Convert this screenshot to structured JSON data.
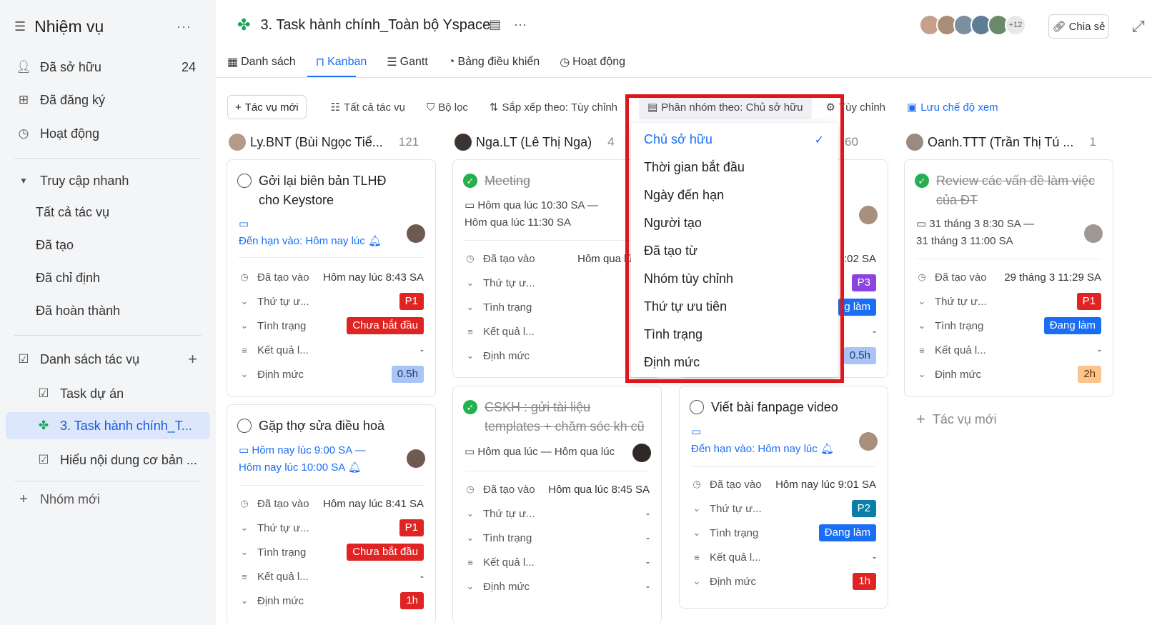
{
  "sidebar": {
    "title": "Nhiệm vụ",
    "more": "···",
    "items": [
      {
        "label": "Đã sở hữu",
        "count": "24"
      },
      {
        "label": "Đã đăng ký"
      },
      {
        "label": "Hoạt động"
      }
    ],
    "quick_access": {
      "label": "Truy cập nhanh",
      "items": [
        "Tất cả tác vụ",
        "Đã tạo",
        "Đã chỉ định",
        "Đã hoàn thành"
      ]
    },
    "task_lists": {
      "label": "Danh sách tác vụ",
      "items": [
        "Task dự án",
        "3. Task hành chính_T...",
        "Hiểu nội dung cơ bản ..."
      ]
    },
    "new_group": "Nhóm mới"
  },
  "header": {
    "title": "3. Task hành chính_Toàn bộ Yspace",
    "avatars_more": "+12",
    "share": "Chia sẻ"
  },
  "tabs": [
    "Danh sách",
    "Kanban",
    "Gantt",
    "Bảng điều khiển",
    "Hoạt động"
  ],
  "toolbar": {
    "new_task": "Tác vụ mới",
    "all_tasks": "Tất cả tác vụ",
    "filter": "Bộ lọc",
    "sort": "Sắp xếp theo: Tùy chỉnh",
    "group": "Phân nhóm theo: Chủ sở hữu",
    "customize": "Tùy chỉnh",
    "save_view": "Lưu chế độ xem"
  },
  "columns": [
    {
      "name": "Ly.BNT (Bùi Ngọc Tiể...",
      "count": "121"
    },
    {
      "name": "Nga.LT (Lê Thị Nga)",
      "count": "4"
    },
    {
      "name": "",
      "count": "60"
    },
    {
      "name": "Oanh.TTT (Trần Thị Tú ...",
      "count": "1"
    }
  ],
  "fields": {
    "created": "Đã tạo vào",
    "priority": "Thứ tự ư...",
    "status": "Tình trạng",
    "result": "Kết quả l...",
    "estimate": "Định mức"
  },
  "cards": {
    "c1": {
      "title": "Gởi lại biên bản TLHĐ cho Keystore",
      "due": "Đến hạn vào: Hôm nay lúc",
      "created": "Hôm nay lúc 8:43 SA",
      "priority": "P1",
      "status": "Chưa bắt đầu",
      "result": "-",
      "estimate": "0.5h"
    },
    "c2": {
      "title": "Gặp thợ sửa điều hoà",
      "date1": "Hôm nay lúc 9:00 SA —",
      "date2": "Hôm nay lúc 10:00 SA",
      "created": "Hôm nay lúc 8:41 SA",
      "priority": "P1",
      "status": "Chưa bắt đầu",
      "result": "-",
      "estimate": "1h"
    },
    "c3": {
      "title": "Meeting",
      "date1": "Hôm qua lúc 10:30 SA —",
      "date2": "Hôm qua lúc 11:30 SA",
      "created": "Hôm qua lúc 8:"
    },
    "c4": {
      "title": "CSKH : gửi tài liệu templates + chăm sóc kh cũ",
      "date1": "Hôm qua lúc — Hôm qua lúc",
      "created": "Hôm qua lúc 8:45 SA",
      "priority": "-",
      "status": "-",
      "result": "-",
      "estimate": "-"
    },
    "c5": {
      "created": ":02 SA",
      "priority": "P3",
      "status": "g làm",
      "result": "-",
      "estimate": "0.5h"
    },
    "c6": {
      "title": "Viết bài fanpage video",
      "due": "Đến hạn vào: Hôm nay lúc",
      "created": "Hôm nay lúc 9:01 SA",
      "priority": "P2",
      "status": "Đang làm",
      "result": "-",
      "estimate": "1h"
    },
    "c7": {
      "title": "Review các vấn đề làm việc của ĐT",
      "date1": "31 tháng 3 8:30 SA —",
      "date2": "31 tháng 3 11:00 SA",
      "created": "29 tháng 3 11:29 SA",
      "priority": "P1",
      "status": "Đang làm",
      "result": "-",
      "estimate": "2h"
    }
  },
  "add_task": "Tác vụ mới",
  "dropdown": {
    "items": [
      "Chủ sở hữu",
      "Thời gian bắt đầu",
      "Ngày đến hạn",
      "Người tạo",
      "Đã tạo từ",
      "Nhóm tùy chỉnh",
      "Thứ tự ưu tiên",
      "Tình trạng",
      "Định mức"
    ],
    "selected": "Chủ sở hữu"
  },
  "colors": {
    "accent": "#1a6ef5",
    "highlight": "#e0161d",
    "done": "#22b14c",
    "p1": "#e02424"
  }
}
